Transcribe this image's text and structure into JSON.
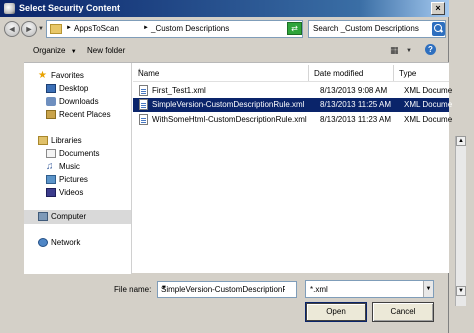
{
  "window": {
    "title": "Select Security Content",
    "close_glyph": "×"
  },
  "nav": {
    "back_glyph": "◄",
    "forward_glyph": "►",
    "breadcrumbs": [
      "AppsToScan",
      "_Custom Descriptions"
    ],
    "separator": "►",
    "drop_glyph": "▼",
    "refresh_glyph": "⇄",
    "search_placeholder": "Search _Custom Descriptions"
  },
  "toolbar": {
    "organize_label": "Organize",
    "new_folder_label": "New folder",
    "drop_glyph": "▼",
    "view_glyph": "▦",
    "help_glyph": "?"
  },
  "sidebar": {
    "favorites": {
      "label": "Favorites",
      "items": [
        "Desktop",
        "Downloads",
        "Recent Places"
      ]
    },
    "libraries": {
      "label": "Libraries",
      "items": [
        "Documents",
        "Music",
        "Pictures",
        "Videos"
      ]
    },
    "computer": "Computer",
    "network": "Network"
  },
  "files": {
    "columns": [
      "Name",
      "Date modified",
      "Type"
    ],
    "sort_glyph": "^",
    "rows": [
      {
        "name": "First_Test1.xml",
        "date": "8/13/2013 9:08 AM",
        "type": "XML Docume",
        "selected": false
      },
      {
        "name": "SimpleVersion-CustomDescriptionRule.xml",
        "date": "8/13/2013 11:25 AM",
        "type": "XML Docume",
        "selected": true
      },
      {
        "name": "WithSomeHtml-CustomDescriptionRule.xml",
        "date": "8/13/2013 11:23 AM",
        "type": "XML Docume",
        "selected": false
      }
    ]
  },
  "bottom": {
    "file_name_label": "File name:",
    "file_name_value": "SimpleVersion-CustomDescriptionR",
    "filter_value": "*.xml",
    "open_label": "Open",
    "cancel_label": "Cancel",
    "drop_glyph": "▼"
  }
}
